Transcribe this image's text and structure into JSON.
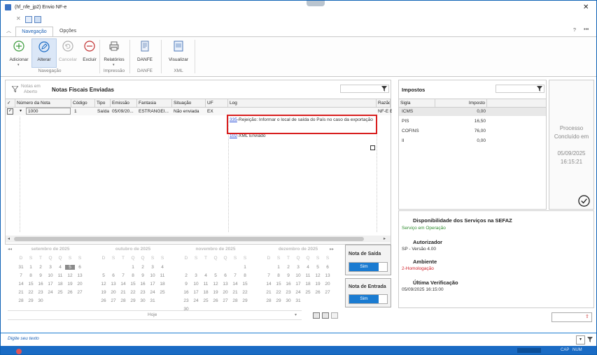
{
  "window": {
    "title": "(hf_nfe_jp2)  Envio NF-e",
    "close_glyph": "✕",
    "min_glyph": "─",
    "max_glyph": "☐"
  },
  "ribbon": {
    "tabs": [
      {
        "label": "Navegação"
      },
      {
        "label": "Opções"
      }
    ],
    "help": "?",
    "more": "•••",
    "buttons": [
      {
        "label": "Adicionar",
        "icon": "plus-icon"
      },
      {
        "label": "Alterar",
        "icon": "pencil-icon"
      },
      {
        "label": "Cancelar",
        "icon": "undo-icon"
      },
      {
        "label": "Excluir",
        "icon": "minus-icon"
      },
      {
        "label": "Relatórios",
        "icon": "printer-icon"
      },
      {
        "label": "DANFE",
        "icon": "document-icon"
      },
      {
        "label": "Visualizar",
        "icon": "preview-icon"
      }
    ],
    "groups": [
      "Navegação",
      "Impressão",
      "DANFE",
      "XML"
    ]
  },
  "grid": {
    "filter_label_line1": "Notas em",
    "filter_label_line2": "Aberto",
    "title": "Notas Fiscais Enviadas",
    "columns": [
      "Número da Nota",
      "Código",
      "Tipo",
      "Emissão",
      "Fantasia",
      "Situação",
      "UF",
      "Log",
      "Razão"
    ],
    "row": {
      "numero": "1000",
      "codigo": "1",
      "tipo": "Saída",
      "emissao": "05/09/20...",
      "fantasia": "ESTRANGEI...",
      "situacao": "Não enviada",
      "uf": "EX",
      "razao": "NF-E E"
    },
    "log": [
      {
        "code": "335",
        "text": "-Rejeição: Informar o local de saída do País no caso da exportação"
      },
      {
        "code": "102",
        "text": "-XML Enviado"
      }
    ]
  },
  "calendar": {
    "weekdays": [
      "D",
      "S",
      "T",
      "Q",
      "Q",
      "S",
      "S"
    ],
    "months": [
      {
        "title": "setembro de 2025",
        "weeks": [
          [
            "31",
            "1",
            "2",
            "3",
            "4",
            "5",
            "6"
          ],
          [
            "7",
            "8",
            "9",
            "10",
            "11",
            "12",
            "13"
          ],
          [
            "14",
            "15",
            "16",
            "17",
            "18",
            "19",
            "20"
          ],
          [
            "21",
            "22",
            "23",
            "24",
            "25",
            "26",
            "27"
          ],
          [
            "28",
            "29",
            "30",
            "",
            "",
            "",
            ""
          ]
        ],
        "selected": "5"
      },
      {
        "title": "outubro de 2025",
        "weeks": [
          [
            "",
            "",
            "",
            "1",
            "2",
            "3",
            "4"
          ],
          [
            "5",
            "6",
            "7",
            "8",
            "9",
            "10",
            "11"
          ],
          [
            "12",
            "13",
            "14",
            "15",
            "16",
            "17",
            "18"
          ],
          [
            "19",
            "20",
            "21",
            "22",
            "23",
            "24",
            "25"
          ],
          [
            "26",
            "27",
            "28",
            "29",
            "30",
            "31",
            ""
          ]
        ]
      },
      {
        "title": "novembro de 2025",
        "weeks": [
          [
            "",
            "",
            "",
            "",
            "",
            "",
            "1"
          ],
          [
            "2",
            "3",
            "4",
            "5",
            "6",
            "7",
            "8"
          ],
          [
            "9",
            "10",
            "11",
            "12",
            "13",
            "14",
            "15"
          ],
          [
            "16",
            "17",
            "18",
            "19",
            "20",
            "21",
            "22"
          ],
          [
            "23",
            "24",
            "25",
            "26",
            "27",
            "28",
            "29"
          ],
          [
            "30",
            "",
            "",
            "",
            "",
            "",
            ""
          ]
        ]
      },
      {
        "title": "dezembro de 2025",
        "weeks": [
          [
            "",
            "1",
            "2",
            "3",
            "4",
            "5",
            "6"
          ],
          [
            "7",
            "8",
            "9",
            "10",
            "11",
            "12",
            "13"
          ],
          [
            "14",
            "15",
            "16",
            "17",
            "18",
            "19",
            "20"
          ],
          [
            "21",
            "22",
            "23",
            "24",
            "25",
            "26",
            "27"
          ],
          [
            "28",
            "29",
            "30",
            "31",
            "",
            "",
            ""
          ]
        ]
      }
    ],
    "today_label": "Hoje",
    "nav_prev": "◂◂",
    "nav_next": "▸▸"
  },
  "toggles": [
    {
      "title": "Nota de Saída",
      "value": "Sim"
    },
    {
      "title": "Nota de Entrada",
      "value": "Sim"
    }
  ],
  "taxes": {
    "title": "Impostos",
    "columns": [
      "Sigla",
      "Imposto"
    ],
    "rows": [
      {
        "sigla": "ICMS",
        "valor": "0,00"
      },
      {
        "sigla": "PIS",
        "valor": "16,50"
      },
      {
        "sigla": "COFINS",
        "valor": "76,00"
      },
      {
        "sigla": "II",
        "valor": "0,00"
      }
    ]
  },
  "process": {
    "line1": "Processo",
    "line2": "Concluído em",
    "date": "05/09/2025",
    "time": "16:15:21"
  },
  "sefaz": {
    "title": "Disponibilidade dos Serviços na SEFAZ",
    "status": "Serviço em Operação",
    "autorizador_title": "Autorizador",
    "autorizador_value": "SP - Versão 4.00",
    "ambiente_title": "Ambiente",
    "ambiente_value": "2-Homologação",
    "ultima_title": "Última Verificação",
    "ultima_value": "05/09/2025 16:15:00"
  },
  "command": {
    "placeholder": "Digite seu texto"
  },
  "statusbar": {
    "caps": "CAP",
    "num": "NUM"
  },
  "colors": {
    "accent": "#1a7bd1",
    "status_ok": "#2e8b2e",
    "status_warn": "#d0202a",
    "highlight": "#d81e1e"
  }
}
